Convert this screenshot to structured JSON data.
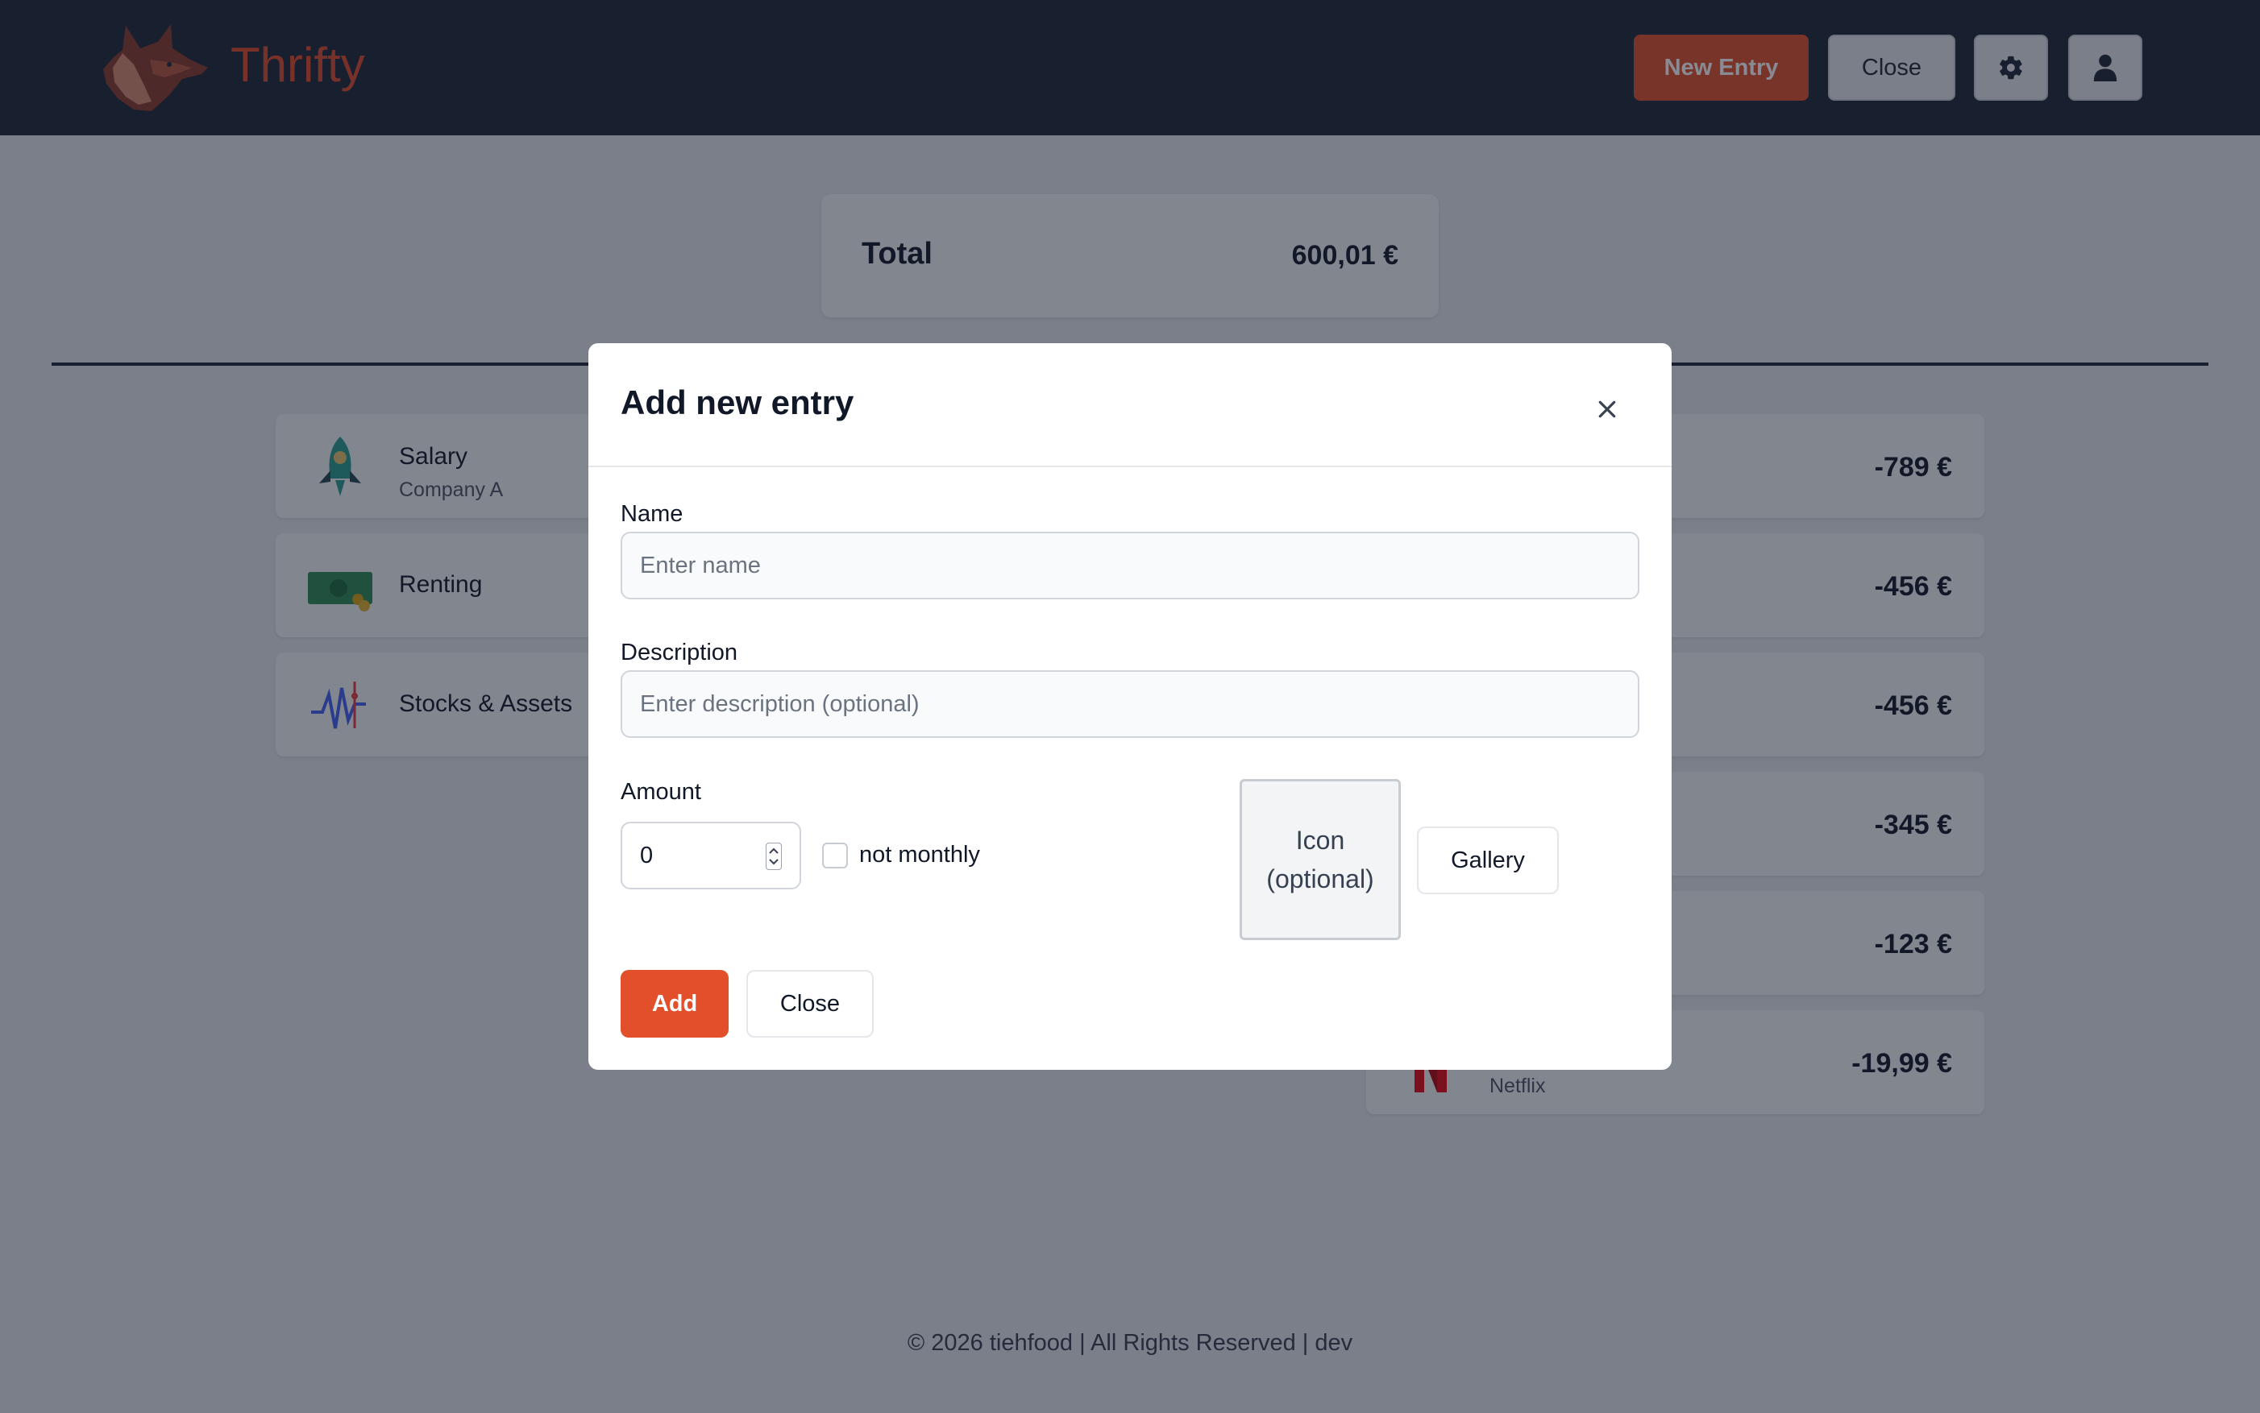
{
  "header": {
    "brand": "Thrifty",
    "new_entry_label": "New Entry",
    "close_label": "Close",
    "settings_icon": "gear-icon",
    "profile_icon": "user-icon",
    "accent_color": "#e1502b"
  },
  "summary": {
    "total_label": "Total",
    "total_value": "600,01 €"
  },
  "income_items": [
    {
      "name": "Salary",
      "description": "Company A",
      "icon": "rocket-icon"
    },
    {
      "name": "Renting",
      "description": "",
      "icon": "money-icon"
    },
    {
      "name": "Stocks & Assets",
      "description": "",
      "icon": "stock-chart-icon"
    }
  ],
  "expense_items": [
    {
      "amount": "-789 €"
    },
    {
      "amount": "-456 €"
    },
    {
      "amount": "-456 €"
    },
    {
      "amount": "-345 €"
    },
    {
      "amount": "-123 €"
    },
    {
      "description": "Netflix",
      "amount": "-19,99 €",
      "icon": "netflix-icon"
    }
  ],
  "footer": {
    "text": "© 2026 tiehfood | All Rights Reserved | dev"
  },
  "modal": {
    "title": "Add new entry",
    "close_icon": "close-icon",
    "name_label": "Name",
    "name_placeholder": "Enter name",
    "name_value": "",
    "description_label": "Description",
    "description_placeholder": "Enter description (optional)",
    "description_value": "",
    "amount_label": "Amount",
    "amount_value": "0",
    "not_monthly_label": "not monthly",
    "not_monthly_checked": false,
    "icon_line1": "Icon",
    "icon_line2": "(optional)",
    "gallery_label": "Gallery",
    "add_label": "Add",
    "close_label": "Close"
  }
}
